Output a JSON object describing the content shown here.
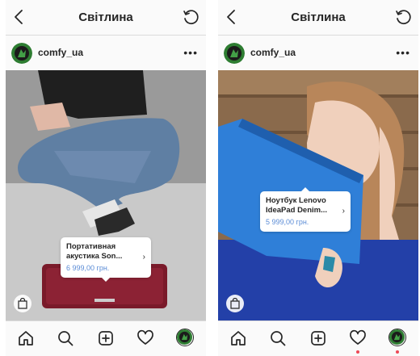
{
  "accent_color": "#5b8cd6",
  "notification_color": "#ed4956",
  "screens": [
    {
      "topbar": {
        "title": "Світлина",
        "back_icon": "chevron-left-icon",
        "refresh_icon": "refresh-icon"
      },
      "post": {
        "username": "comfy_ua",
        "more_icon": "more-icon",
        "more_label": "•••",
        "tag": {
          "name_line1": "Портативная",
          "name_line2": "акустика Son...",
          "price": "6 999,00 грн.",
          "arrow": "›"
        },
        "shopping_icon": "shopping-bag-icon"
      },
      "nav": {
        "items": [
          "home-icon",
          "search-icon",
          "new-post-icon",
          "heart-icon",
          "profile-avatar"
        ]
      }
    },
    {
      "topbar": {
        "title": "Світлина",
        "back_icon": "chevron-left-icon",
        "refresh_icon": "refresh-icon"
      },
      "post": {
        "username": "comfy_ua",
        "more_icon": "more-icon",
        "more_label": "•••",
        "tag": {
          "name_line1": "Ноутбук Lenovo",
          "name_line2": "IdeaPad Denim...",
          "price": "5 999,00 грн.",
          "arrow": "›"
        },
        "shopping_icon": "shopping-bag-icon"
      },
      "nav": {
        "items": [
          "home-icon",
          "search-icon",
          "new-post-icon",
          "heart-icon",
          "profile-avatar"
        ],
        "notification_dots": [
          "heart-icon",
          "profile-avatar"
        ]
      }
    }
  ]
}
